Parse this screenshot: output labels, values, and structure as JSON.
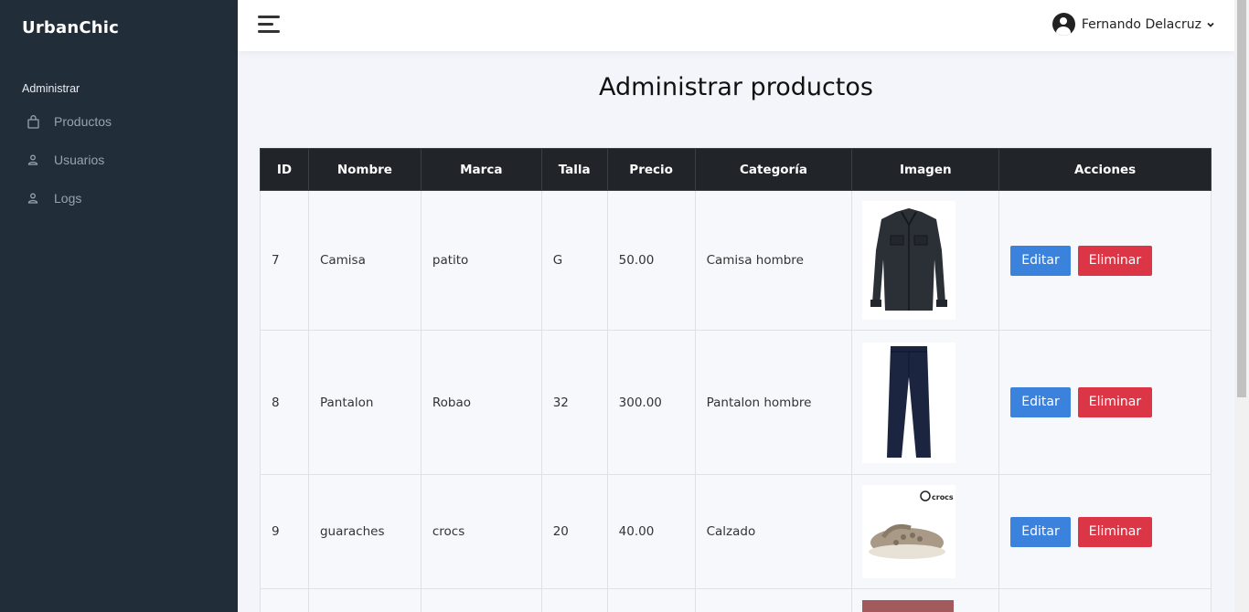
{
  "sidebar": {
    "brand": "UrbanChic",
    "section_label": "Administrar",
    "items": [
      {
        "label": "Productos",
        "icon": "bag-icon"
      },
      {
        "label": "Usuarios",
        "icon": "user-icon"
      },
      {
        "label": "Logs",
        "icon": "user-icon"
      }
    ]
  },
  "topbar": {
    "user_name": "Fernando Delacruz",
    "menu_icon": "hamburger-icon",
    "avatar_icon": "user-circle-icon"
  },
  "main": {
    "title": "Administrar productos",
    "table": {
      "headers": [
        "ID",
        "Nombre",
        "Marca",
        "Talla",
        "Precio",
        "Categoría",
        "Imagen",
        "Acciones"
      ],
      "rows": [
        {
          "id": "7",
          "nombre": "Camisa",
          "marca": "patito",
          "talla": "G",
          "precio": "50.00",
          "categoria": "Camisa hombre",
          "image": "shirt-image"
        },
        {
          "id": "8",
          "nombre": "Pantalon",
          "marca": "Robao",
          "talla": "32",
          "precio": "300.00",
          "categoria": "Pantalon hombre",
          "image": "pants-image"
        },
        {
          "id": "9",
          "nombre": "guaraches",
          "marca": "crocs",
          "talla": "20",
          "precio": "40.00",
          "categoria": "Calzado",
          "image": "crocs-image",
          "image_text": "crocs"
        }
      ],
      "edit_label": "Editar",
      "delete_label": "Eliminar"
    }
  },
  "colors": {
    "sidebar_bg": "#222d3a",
    "table_header_bg": "#212529",
    "edit_button": "#3b82dd",
    "delete_button": "#dc3545"
  }
}
